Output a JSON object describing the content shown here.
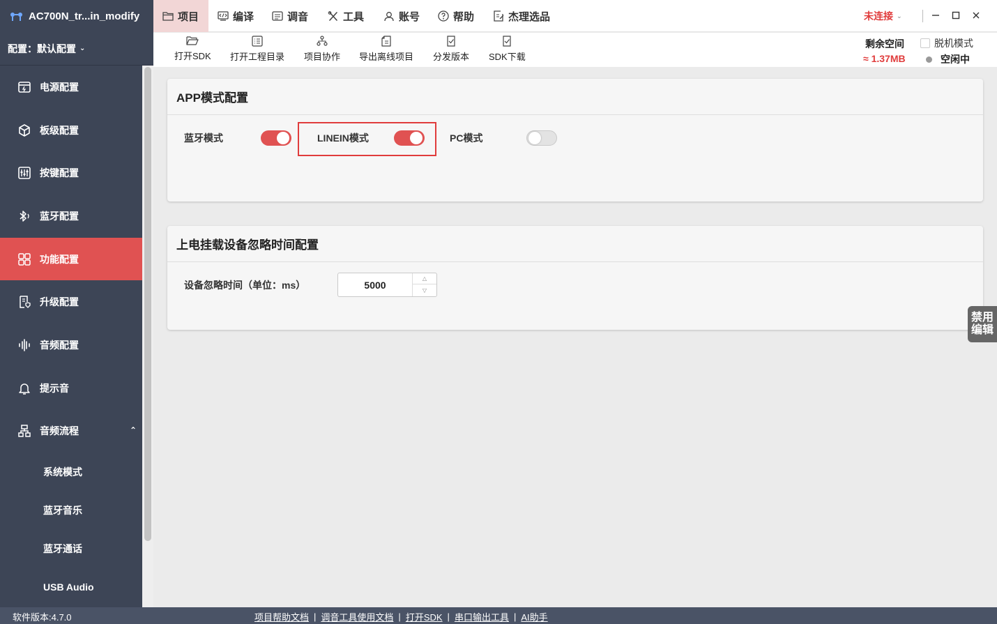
{
  "app": {
    "title": "AC700N_tr...in_modify",
    "config_label": "配置：默认配置"
  },
  "sidebar": {
    "items": [
      {
        "label": "电源配置",
        "icon": "power-config-icon"
      },
      {
        "label": "板级配置",
        "icon": "cube-icon"
      },
      {
        "label": "按键配置",
        "icon": "sliders-icon"
      },
      {
        "label": "蓝牙配置",
        "icon": "bluetooth-icon"
      },
      {
        "label": "功能配置",
        "icon": "grid-icon",
        "active": true
      },
      {
        "label": "升级配置",
        "icon": "upgrade-doc-icon"
      },
      {
        "label": "音频配置",
        "icon": "audio-wave-icon"
      },
      {
        "label": "提示音",
        "icon": "bell-icon"
      },
      {
        "label": "音频流程",
        "icon": "flow-icon",
        "expanded": true
      }
    ],
    "sub_items": [
      "系统模式",
      "蓝牙音乐",
      "蓝牙通话",
      "USB Audio"
    ]
  },
  "menu": {
    "items": [
      {
        "label": "项目",
        "icon": "folder-icon",
        "active": true
      },
      {
        "label": "编译",
        "icon": "code-icon"
      },
      {
        "label": "调音",
        "icon": "tune-icon"
      },
      {
        "label": "工具",
        "icon": "tools-icon"
      },
      {
        "label": "账号",
        "icon": "user-icon"
      },
      {
        "label": "帮助",
        "icon": "help-icon"
      },
      {
        "label": "杰理选品",
        "icon": "select-icon"
      }
    ],
    "connection_status": "未连接"
  },
  "toolbar": {
    "items": [
      "打开SDK",
      "打开工程目录",
      "项目协作",
      "导出离线项目",
      "分发版本",
      "SDK下载"
    ],
    "space_label": "剩余空间",
    "space_value": "≈ 1.37MB",
    "offline_mode": "脱机模式",
    "idle_status": "空闲中"
  },
  "app_mode_panel": {
    "title": "APP模式配置",
    "options": [
      {
        "label": "蓝牙模式",
        "enabled": true
      },
      {
        "label": "LINEIN模式",
        "enabled": true
      },
      {
        "label": "PC模式",
        "enabled": false
      }
    ]
  },
  "ignore_panel": {
    "title": "上电挂载设备忽略时间配置",
    "field_label": "设备忽略时间（单位：ms）",
    "field_value": "5000"
  },
  "float_button": {
    "line1": "禁用",
    "line2": "编辑"
  },
  "status": {
    "version": "软件版本:4.7.0",
    "links": [
      "项目帮助文档",
      "调音工具使用文档",
      "打开SDK",
      "串口输出工具",
      "AI助手"
    ]
  },
  "colors": {
    "sidebar_bg": "#3d4556",
    "accent": "#e05252",
    "error_text": "#e03c3c",
    "statusbar_bg": "#4a5366"
  }
}
